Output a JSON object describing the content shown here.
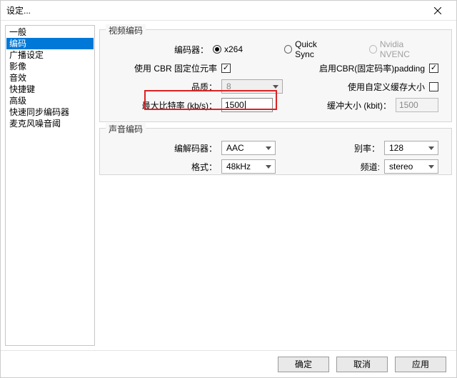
{
  "window": {
    "title": "设定..."
  },
  "sidebar": {
    "items": [
      {
        "label": "一般"
      },
      {
        "label": "编码"
      },
      {
        "label": "广播设定"
      },
      {
        "label": "影像"
      },
      {
        "label": "音效"
      },
      {
        "label": "快捷键"
      },
      {
        "label": "高级"
      },
      {
        "label": "快速同步编码器"
      },
      {
        "label": "麦克风噪音阈"
      }
    ],
    "selected_index": 1
  },
  "video": {
    "group_label": "视频编码",
    "encoder_label": "编码器：",
    "encoder_options": {
      "x264": "x264",
      "quicksync": "Quick Sync",
      "nvenc": "Nvidia NVENC"
    },
    "encoder_selected": "x264",
    "use_cbr_label": "使用 CBR 固定位元率",
    "use_cbr_checked": true,
    "enable_cbr_padding_label": "启用CBR(固定码率)padding",
    "enable_cbr_padding_checked": true,
    "quality_label": "品质：",
    "quality_value": "8",
    "use_custom_buffer_label": "使用自定义缓存大小",
    "use_custom_buffer_checked": false,
    "max_bitrate_label": "最大比特率 (kb/s)：",
    "max_bitrate_value": "1500",
    "buffer_size_label": "缓冲大小 (kbit)：",
    "buffer_size_value": "1500"
  },
  "audio": {
    "group_label": "声音编码",
    "codec_label": "编解码器：",
    "codec_value": "AAC",
    "bitrate_label": "别率：",
    "bitrate_value": "128",
    "format_label": "格式：",
    "format_value": "48kHz",
    "channel_label": "频道:",
    "channel_value": "stereo"
  },
  "footer": {
    "ok": "确定",
    "cancel": "取消",
    "apply": "应用"
  }
}
